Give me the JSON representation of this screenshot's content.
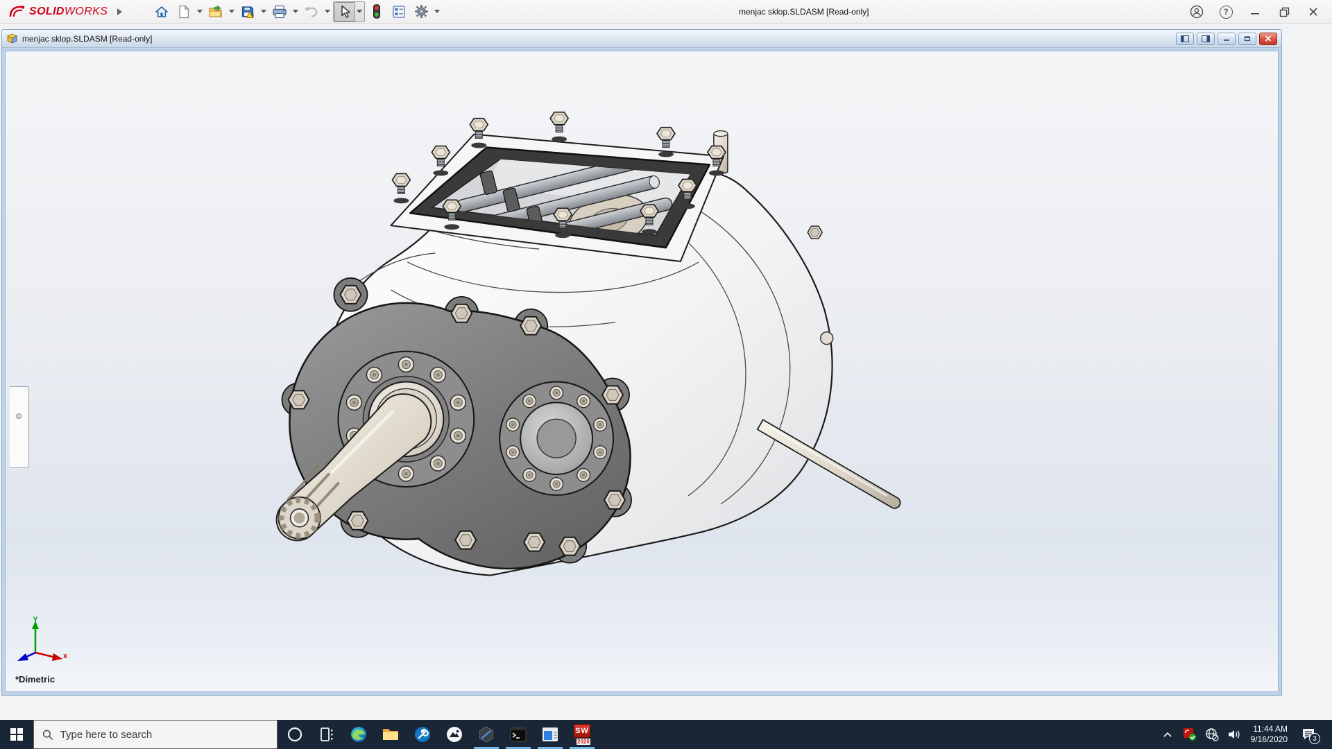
{
  "app": {
    "brand_primary": "SOLID",
    "brand_secondary": "WORKS",
    "brand_color": "#d0021b"
  },
  "window": {
    "title": "menjac sklop.SLDASM [Read-only]",
    "controls": {
      "help_glyph": "?"
    }
  },
  "toolbar": {
    "buttons": [
      {
        "name": "home"
      },
      {
        "name": "new-document",
        "dropdown": true
      },
      {
        "name": "open",
        "dropdown": true
      },
      {
        "name": "save",
        "dropdown": true
      },
      {
        "name": "print",
        "dropdown": true
      },
      {
        "name": "undo",
        "dropdown": true,
        "disabled": true
      },
      {
        "name": "select",
        "dropdown": true,
        "selected": true
      },
      {
        "name": "design-binder-traffic-light"
      },
      {
        "name": "evaluate-list"
      },
      {
        "name": "options-gear",
        "dropdown": true
      }
    ]
  },
  "document_window": {
    "title": "menjac sklop.SLDASM [Read-only]",
    "status_view": "*Dimetric",
    "triad": {
      "y_label": "Y",
      "x_label": "x"
    },
    "model": "gearbox assembly (menjac sklop) shaded-with-edges 3D view"
  },
  "taskbar": {
    "search_placeholder": "Type here to search",
    "icons": [
      "cortana",
      "task-view",
      "edge",
      "file-explorer",
      "admin-wrench",
      "photos",
      "app-hexagon",
      "command-prompt",
      "app-window",
      "solidworks-2020"
    ],
    "active_icons": [
      "app-hexagon",
      "command-prompt",
      "app-window",
      "solidworks-2020"
    ],
    "sw_icon": {
      "letters": "SW",
      "year": "2020"
    }
  },
  "tray": {
    "time": "11:44 AM",
    "date": "9/16/2020",
    "notification_count": "3"
  },
  "colors": {
    "taskbar_bg": "#182636",
    "taskbar_active_underline": "#76b9e8",
    "viewport_top": "#f4f5f7",
    "viewport_bottom": "#dfe5ee",
    "child_window_border": "#bdd3ec",
    "solidworks_red": "#d0021b",
    "flange_gray": "#7f7f7f",
    "bolt_beige": "#dbd3c6"
  }
}
